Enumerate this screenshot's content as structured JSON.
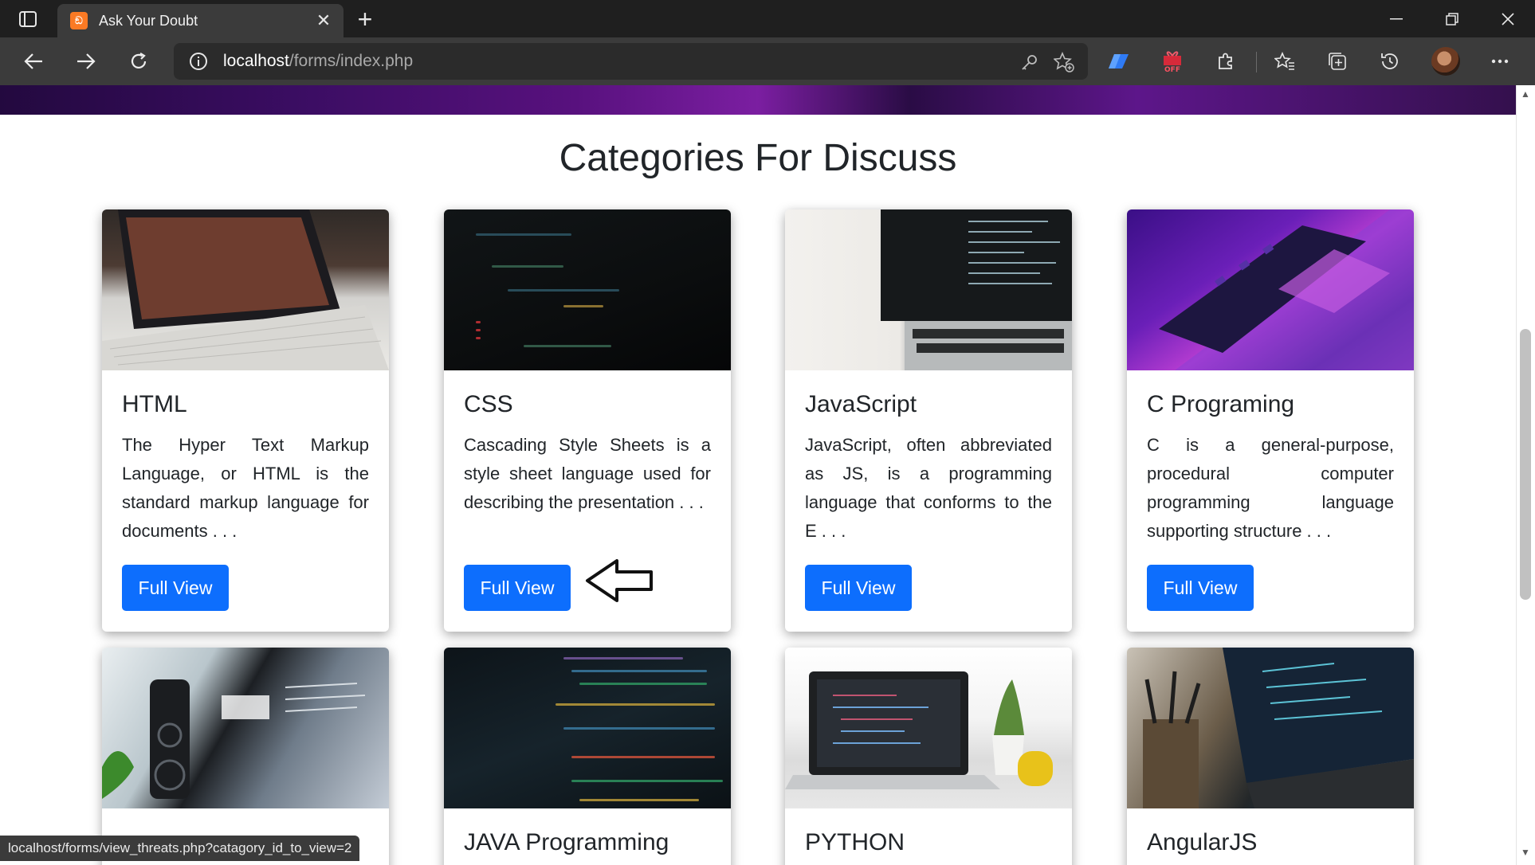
{
  "browser": {
    "tab_title": "Ask Your Doubt",
    "tab_favicon_text": "ඞ",
    "url_host": "localhost",
    "url_path": "/forms/index.php",
    "status_url": "localhost/forms/view_threats.php?catagory_id_to_view=2",
    "extension_off_badge": "OFF"
  },
  "page": {
    "heading": "Categories For Discuss",
    "cards": [
      {
        "title": "HTML",
        "text": "The Hyper Text Markup Language, or HTML is the standard markup language for documents . . .",
        "button": "Full View"
      },
      {
        "title": "CSS",
        "text": "Cascading Style Sheets is a style sheet language used for describing the presentation . . .",
        "button": "Full View"
      },
      {
        "title": "JavaScript",
        "text": "JavaScript, often abbreviated as JS, is a programming language that conforms to the E . . .",
        "button": "Full View"
      },
      {
        "title": "C Programing",
        "text": "C is a general-purpose, procedural computer programming language supporting structure . . .",
        "button": "Full View"
      },
      {
        "title": "",
        "text": "",
        "button": ""
      },
      {
        "title": "JAVA Programming",
        "text": "",
        "button": ""
      },
      {
        "title": "PYTHON",
        "text": "",
        "button": ""
      },
      {
        "title": "AngularJS",
        "text": "",
        "button": ""
      }
    ]
  },
  "colors": {
    "accent": "#0d6efd",
    "hero": "#58117e",
    "chrome_dark": "#1f1f1f",
    "chrome_mid": "#3b3b3b"
  }
}
